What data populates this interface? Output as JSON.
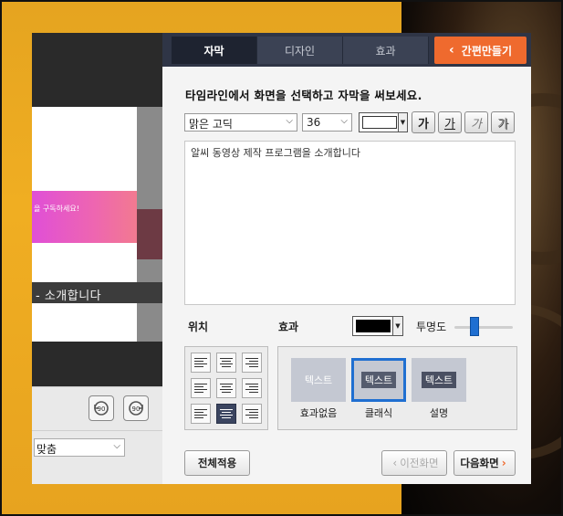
{
  "tabs": [
    {
      "label": "자막",
      "active": true
    },
    {
      "label": "디자인",
      "active": false
    },
    {
      "label": "효과",
      "active": false
    }
  ],
  "quick_make": {
    "label": "간편만들기",
    "icon": "chevron-left-icon",
    "color": "#ef6a2e"
  },
  "instruction": "타임라인에서 화면을 선택하고 자막을 써보세요.",
  "font": {
    "family_value": "맑은 고딕",
    "size_value": "36",
    "text_color": "#ffffff"
  },
  "format_buttons": [
    {
      "label": "가",
      "style": "bold"
    },
    {
      "label": "가",
      "style": "underline"
    },
    {
      "label": "가",
      "style": "italic"
    },
    {
      "label": "가",
      "style": "shadow"
    }
  ],
  "subtitle_text": "알씨 동영상 제작 프로그램을 소개합니다",
  "position": {
    "label": "위치",
    "selected": "bottom-center"
  },
  "effect": {
    "label": "효과",
    "color": "#000000",
    "opacity_label": "투명도",
    "opacity_level": 0.35
  },
  "effect_options": [
    {
      "chip": "텍스트",
      "name": "효과없음",
      "selected": false
    },
    {
      "chip": "텍스트",
      "name": "클래식",
      "selected": true
    },
    {
      "chip": "텍스트",
      "name": "설명",
      "selected": false
    }
  ],
  "buttons": {
    "apply_all": "전체적용",
    "prev": "이전화면",
    "next": "다음화면"
  },
  "preview": {
    "banner_text": "을 구독하세요!",
    "caption_text": "- 소개합니다",
    "rotate_left": "90",
    "rotate_right": "90",
    "fit_value": "맞춤"
  },
  "colors": {
    "tab_bar": "#2f3546",
    "accent_blue": "#1f6fd1",
    "background_orange": "#f0ae22"
  }
}
